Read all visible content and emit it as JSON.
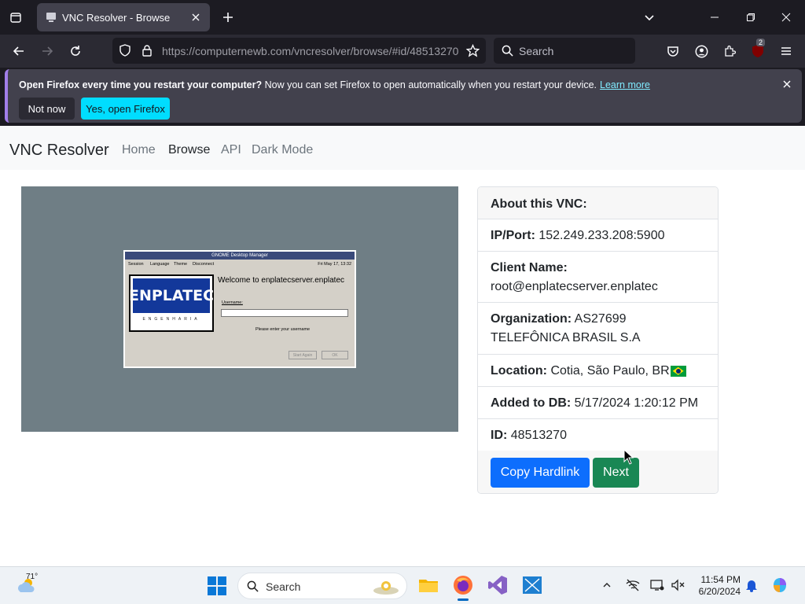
{
  "browser": {
    "tab_title": "VNC Resolver - Browse",
    "url_host": "https://computernewb.com",
    "url_path": "/vncresolver/browse/#id/48513270",
    "search_placeholder": "Search",
    "extension_badge": "2"
  },
  "notification": {
    "bold_text": "Open Firefox every time you restart your computer?",
    "text": " Now you can set Firefox to open automatically when you restart your device.",
    "link_text": "Learn more",
    "not_now_label": "Not now",
    "open_label": "Yes, open Firefox"
  },
  "site": {
    "brand": "VNC Resolver",
    "nav": [
      "Home",
      "Browse",
      "API",
      "Dark Mode"
    ],
    "active_nav": "Browse"
  },
  "vnc_screen": {
    "title": "GNOME Desktop Manager",
    "menu": [
      "Session",
      "Language",
      "Theme",
      "Disconnect"
    ],
    "clock": "Fri May 17, 13:32",
    "logo_text": "ENPLATEC",
    "logo_sub": "ENGENHARIA",
    "welcome": "Welcome to enplatecserver.enplatec",
    "username_label": "Username:",
    "hint": "Please enter your username",
    "btn_start_again": "Start Again",
    "btn_ok": "OK"
  },
  "about": {
    "header": "About this VNC:",
    "ip_label": "IP/Port:",
    "ip_value": "152.249.233.208:5900",
    "client_label": "Client Name:",
    "client_value": "root@enplatecserver.enplatec",
    "org_label": "Organization:",
    "org_value": "AS27699 TELEFÔNICA BRASIL S.A",
    "location_label": "Location:",
    "location_value": "Cotia, São Paulo, BR",
    "added_label": "Added to DB:",
    "added_value": "5/17/2024 1:20:12 PM",
    "id_label": "ID:",
    "id_value": "48513270",
    "copy_label": "Copy Hardlink",
    "next_label": "Next"
  },
  "taskbar": {
    "temperature": "71°",
    "search_placeholder": "Search",
    "time": "11:54 PM",
    "date": "6/20/2024"
  }
}
